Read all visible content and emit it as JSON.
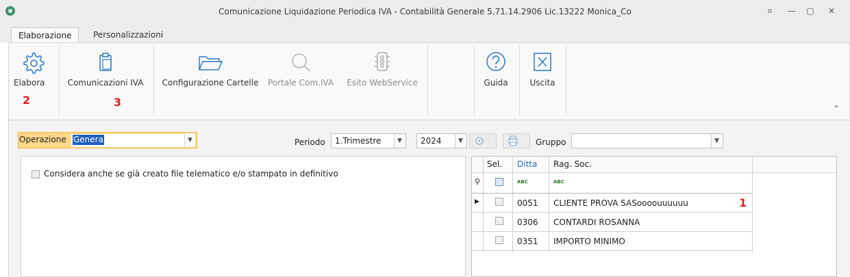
{
  "window": {
    "title": "Comunicazione Liquidazione Periodica IVA - Contabilità Generale 5.71.14.2906 Lic.13222 Monica_Co",
    "controls": [
      "⌗",
      "—",
      "▢",
      "✕"
    ]
  },
  "tabs": [
    {
      "label": "Elaborazione",
      "active": true
    },
    {
      "label": "Personalizzazioni",
      "active": false
    }
  ],
  "ribbon": {
    "elabora": {
      "label": "Elabora",
      "icon": "gear-icon",
      "marker": "2"
    },
    "comunicazioni": {
      "label": "Comunicazioni IVA",
      "icon": "clipboard-icon",
      "marker": "3"
    },
    "configurazione": {
      "label": "Configurazione Cartelle",
      "icon": "folder-icon"
    },
    "portale": {
      "label": "Portale Com.IVA",
      "icon": "magnifier-icon",
      "disabled": true
    },
    "esito": {
      "label": "Esito WebService",
      "icon": "server-icon",
      "disabled": true
    },
    "guida": {
      "label": "Guida",
      "icon": "help-circle-icon"
    },
    "uscita": {
      "label": "Uscita",
      "icon": "exit-x-icon"
    }
  },
  "filters": {
    "operazione_label": "Operazione",
    "operazione_value": "Genera",
    "periodo_label": "Periodo",
    "periodo_value": "1.Trimestre",
    "anno_value": "2024",
    "gruppo_label": "Gruppo",
    "gruppo_value": ""
  },
  "options": {
    "considera_label": "Considera anche se già creato file telematico e/o stampato in definitivo",
    "considera_checked": false
  },
  "grid": {
    "columns": [
      "Sel.",
      "Ditta",
      "Rag. Soc."
    ],
    "filter_row_badge": "ABC",
    "rows": [
      {
        "sel": false,
        "ditta": "0051",
        "rag_soc": "CLIENTE PROVA SASoooouuuuuu",
        "current": true,
        "marker": "1"
      },
      {
        "sel": false,
        "ditta": "0306",
        "rag_soc": "CONTARDI ROSANNA",
        "current": false
      },
      {
        "sel": false,
        "ditta": "0351",
        "rag_soc": "IMPORTO MINIMO",
        "current": false
      }
    ]
  }
}
